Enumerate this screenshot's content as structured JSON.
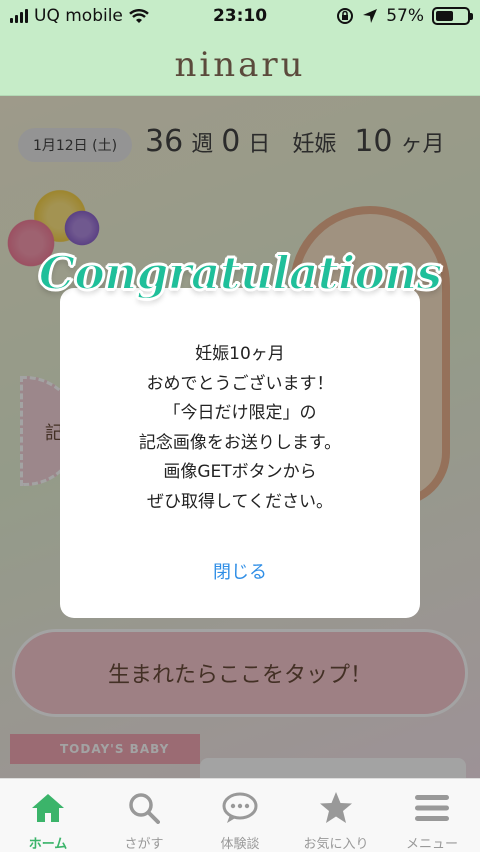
{
  "status_bar": {
    "carrier": "UQ mobile",
    "time": "23:10",
    "battery_percent": "57%",
    "battery_level": 0.57
  },
  "header": {
    "logo": "ninaru"
  },
  "pregnancy": {
    "date": "1月12日 (土)",
    "week_number": "36",
    "week_unit": "週",
    "day_number": "0",
    "day_unit": "日",
    "month_label": "妊娠",
    "month_number": "10",
    "month_unit": "ヶ月"
  },
  "background": {
    "tap_banner": "生まれたらここをタップ！",
    "today_ribbon": "TODAY'S BABY",
    "side_badge_char": "記",
    "colors": {
      "header": "#c6ecc8",
      "accent_green": "#3bb46a",
      "link_blue": "#2f8ee6",
      "congrats_teal": "#1fbf9a"
    }
  },
  "dialog": {
    "title": "Congratulations",
    "message_lines": [
      "妊娠10ヶ月",
      "おめでとうございます！",
      "「今日だけ限定」の",
      "記念画像をお送りします。",
      "画像GETボタンから",
      "ぜひ取得してください。"
    ],
    "close_label": "閉じる"
  },
  "tabbar": {
    "items": [
      {
        "label": "ホーム",
        "icon": "home-icon",
        "active": true
      },
      {
        "label": "さがす",
        "icon": "search-icon",
        "active": false
      },
      {
        "label": "体験談",
        "icon": "chat-bubble-icon",
        "active": false
      },
      {
        "label": "お気に入り",
        "icon": "star-icon",
        "active": false
      },
      {
        "label": "メニュー",
        "icon": "menu-icon",
        "active": false
      }
    ]
  }
}
